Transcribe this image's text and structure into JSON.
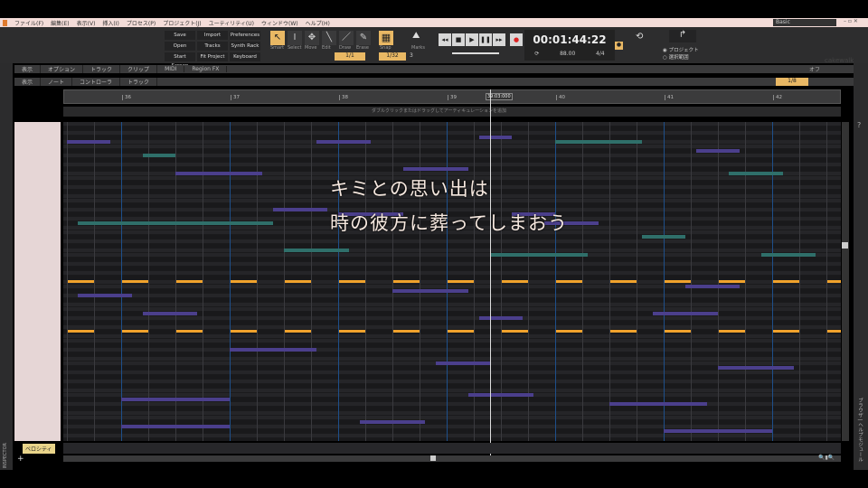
{
  "menu": [
    "ファイル(F)",
    "編集(E)",
    "表示(V)",
    "挿入(I)",
    "プロセス(P)",
    "プロジェクト(J)",
    "ユーティリティ(U)",
    "ウィンドウ(W)",
    "ヘルプ(H)"
  ],
  "workspace": "Basic",
  "quick_buttons": [
    "Save",
    "Import",
    "Preferences",
    "Open",
    "Tracks",
    "Synth Rack",
    "Start Screen",
    "Fit Project",
    "Keyboard"
  ],
  "tools": [
    {
      "label": "Smart",
      "icon": "smart-arrow-icon",
      "active": true
    },
    {
      "label": "Select",
      "icon": "i-beam-icon"
    },
    {
      "label": "Move",
      "icon": "move-icon"
    },
    {
      "label": "Edit",
      "icon": "edit-icon"
    },
    {
      "label": "Draw",
      "icon": "pencil-icon"
    },
    {
      "label": "Erase",
      "icon": "eraser-icon"
    }
  ],
  "tool_resolution": "1/1",
  "snap": {
    "label": "Snap",
    "value": "1/32",
    "triplet": "3"
  },
  "marks_label": "Marks",
  "transport": {
    "time": "00:01:44:22",
    "tempo": "88.00",
    "meter": "4/4",
    "playing": true
  },
  "export": {
    "option1": "プロジェクト",
    "option2": "選択範囲",
    "selected": "option1"
  },
  "logo": "cakewalk",
  "track_menu": [
    "表示",
    "オプション",
    "トラック",
    "クリップ",
    "MIDI",
    "Region FX"
  ],
  "track_right": "オフ",
  "pr_menu": [
    "表示",
    "ノート",
    "コントローラ",
    "トラック"
  ],
  "pr_snap": "1/8",
  "ruler": {
    "measures": [
      "36",
      "37",
      "38",
      "39",
      "40",
      "41",
      "42"
    ],
    "now": "39:03:000"
  },
  "articulation_hint": "ダブルクリックまたはドラッグしてアーティキュレーションを追加",
  "velocity_tab": "ベロシティ",
  "inspector_label": "INSPECTOR",
  "right_panel_label": "ブラウザ | ヘルプモジュール",
  "lyrics": [
    "キミとの思い出は",
    "時の彼方に葬ってしまおう"
  ],
  "colors": {
    "accent": "#e9b864",
    "note_orange": "#f0a22c",
    "note_purple": "#4b3f8c",
    "note_teal": "#2f6f6a",
    "menubar": "#f3dcd8"
  },
  "notes": [
    {
      "bar": 35.5,
      "len": 0.4,
      "row": 4,
      "c": "p"
    },
    {
      "bar": 36.2,
      "len": 0.3,
      "row": 7,
      "c": "t"
    },
    {
      "bar": 37.8,
      "len": 0.5,
      "row": 4,
      "c": "p"
    },
    {
      "bar": 39.3,
      "len": 0.3,
      "row": 3,
      "c": "p"
    },
    {
      "bar": 40.0,
      "len": 0.8,
      "row": 4,
      "c": "t"
    },
    {
      "bar": 41.3,
      "len": 0.4,
      "row": 6,
      "c": "p"
    },
    {
      "bar": 36.5,
      "len": 0.8,
      "row": 11,
      "c": "p"
    },
    {
      "bar": 38.6,
      "len": 0.6,
      "row": 10,
      "c": "p"
    },
    {
      "bar": 41.6,
      "len": 0.5,
      "row": 11,
      "c": "t"
    },
    {
      "bar": 37.4,
      "len": 0.5,
      "row": 19,
      "c": "p"
    },
    {
      "bar": 38.0,
      "len": 0.6,
      "row": 20,
      "c": "p"
    },
    {
      "bar": 39.6,
      "len": 0.4,
      "row": 20,
      "c": "p"
    },
    {
      "bar": 35.6,
      "len": 1.8,
      "row": 22,
      "c": "t"
    },
    {
      "bar": 39.9,
      "len": 0.5,
      "row": 22,
      "c": "p"
    },
    {
      "bar": 40.8,
      "len": 0.4,
      "row": 25,
      "c": "t"
    },
    {
      "bar": 37.5,
      "len": 0.6,
      "row": 28,
      "c": "t"
    },
    {
      "bar": 39.4,
      "len": 0.9,
      "row": 29,
      "c": "t"
    },
    {
      "bar": 41.9,
      "len": 0.5,
      "row": 29,
      "c": "t"
    },
    {
      "bar": 35.6,
      "len": 0.5,
      "row": 38,
      "c": "p"
    },
    {
      "bar": 38.5,
      "len": 0.7,
      "row": 37,
      "c": "p"
    },
    {
      "bar": 41.2,
      "len": 0.5,
      "row": 36,
      "c": "p"
    },
    {
      "bar": 36.2,
      "len": 0.5,
      "row": 42,
      "c": "p"
    },
    {
      "bar": 39.3,
      "len": 0.4,
      "row": 43,
      "c": "p"
    },
    {
      "bar": 40.9,
      "len": 0.6,
      "row": 42,
      "c": "p"
    },
    {
      "bar": 37.0,
      "len": 0.8,
      "row": 50,
      "c": "p"
    },
    {
      "bar": 38.9,
      "len": 0.5,
      "row": 53,
      "c": "p"
    },
    {
      "bar": 41.5,
      "len": 0.7,
      "row": 54,
      "c": "p"
    },
    {
      "bar": 36.0,
      "len": 1.0,
      "row": 61,
      "c": "p"
    },
    {
      "bar": 39.2,
      "len": 0.6,
      "row": 60,
      "c": "p"
    },
    {
      "bar": 40.5,
      "len": 0.9,
      "row": 62,
      "c": "p"
    },
    {
      "bar": 36.0,
      "len": 1.0,
      "row": 67,
      "c": "p"
    },
    {
      "bar": 38.2,
      "len": 0.6,
      "row": 66,
      "c": "p"
    },
    {
      "bar": 41.0,
      "len": 1.0,
      "row": 68,
      "c": "p"
    }
  ],
  "orange_rows": [
    35,
    46
  ]
}
